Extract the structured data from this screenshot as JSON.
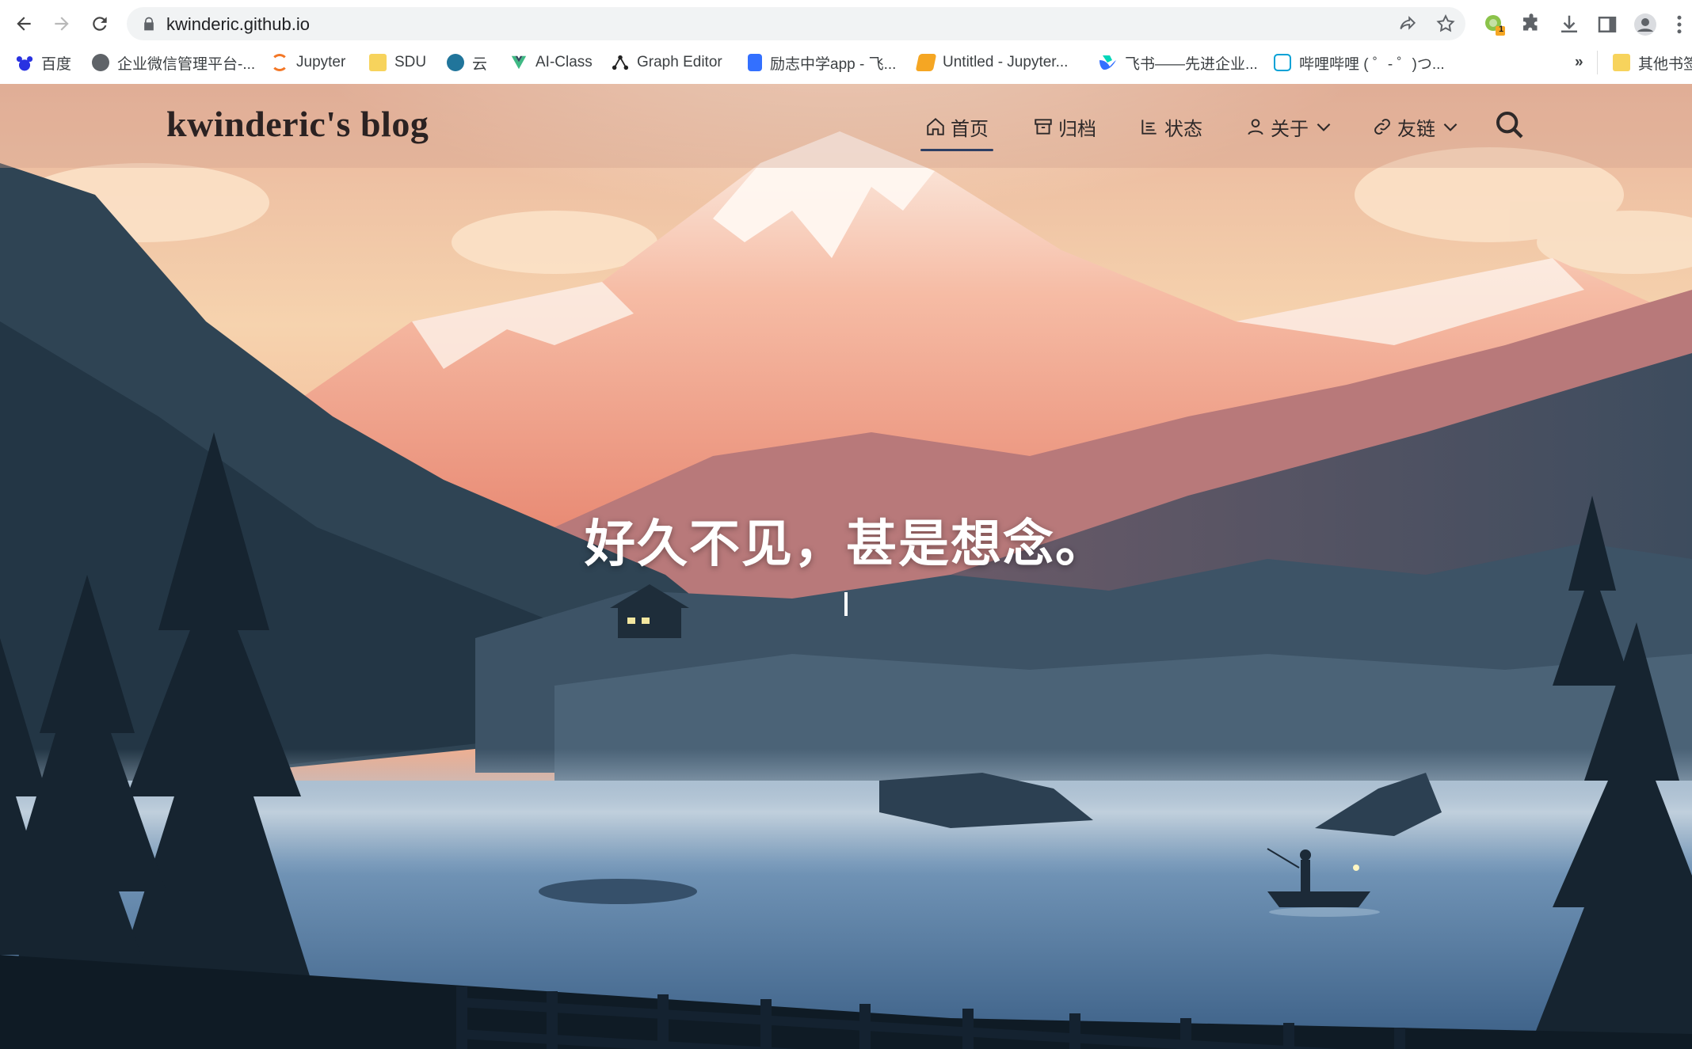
{
  "browser": {
    "url": "kwinderic.github.io",
    "extension_badge": "1",
    "bookmarks": [
      {
        "label": "百度",
        "icon": "baidu-paw-icon",
        "color": "#2932e1"
      },
      {
        "label": "企业微信管理平台-...",
        "icon": "globe-icon",
        "color": "#5f6368"
      },
      {
        "label": "Jupyter",
        "icon": "jupyter-icon",
        "color": "#f37726"
      },
      {
        "label": "SDU",
        "icon": "folder-icon",
        "color": "#f7d35c"
      },
      {
        "label": "云",
        "icon": "wordpress-icon",
        "color": "#21759b"
      },
      {
        "label": "AI-Class",
        "icon": "vue-icon",
        "color": "#3fb984"
      },
      {
        "label": "Graph Editor",
        "icon": "graph-icon",
        "color": "#222222"
      },
      {
        "label": "励志中学app - 飞...",
        "icon": "doc-icon",
        "color": "#3370ff"
      },
      {
        "label": "Untitled - Jupyter...",
        "icon": "notebook-icon",
        "color": "#f5a623"
      },
      {
        "label": "飞书——先进企业...",
        "icon": "feishu-icon",
        "color": "#3370ff"
      },
      {
        "label": "哔哩哔哩 ( ゜- ゜)つ...",
        "icon": "bilibili-icon",
        "color": "#00a1d6"
      }
    ],
    "more_bookmarks": "»",
    "other_bookmarks": "其他书签"
  },
  "site": {
    "brand": "kwinderic's blog",
    "menu": [
      {
        "label": "首页",
        "icon": "home-icon",
        "active": true
      },
      {
        "label": "归档",
        "icon": "archive-icon"
      },
      {
        "label": "状态",
        "icon": "list-icon"
      },
      {
        "label": "关于",
        "icon": "user-icon",
        "dropdown": true
      },
      {
        "label": "友链",
        "icon": "link-icon",
        "dropdown": true
      }
    ],
    "hero_title": "好久不见，甚是想念。"
  },
  "colors": {
    "accent": "#2e3f63",
    "sky_top": "#f3c6a4",
    "mountain": "#f0977e",
    "lake": "#5b86ad",
    "forest_dark": "#1d2f3d"
  }
}
